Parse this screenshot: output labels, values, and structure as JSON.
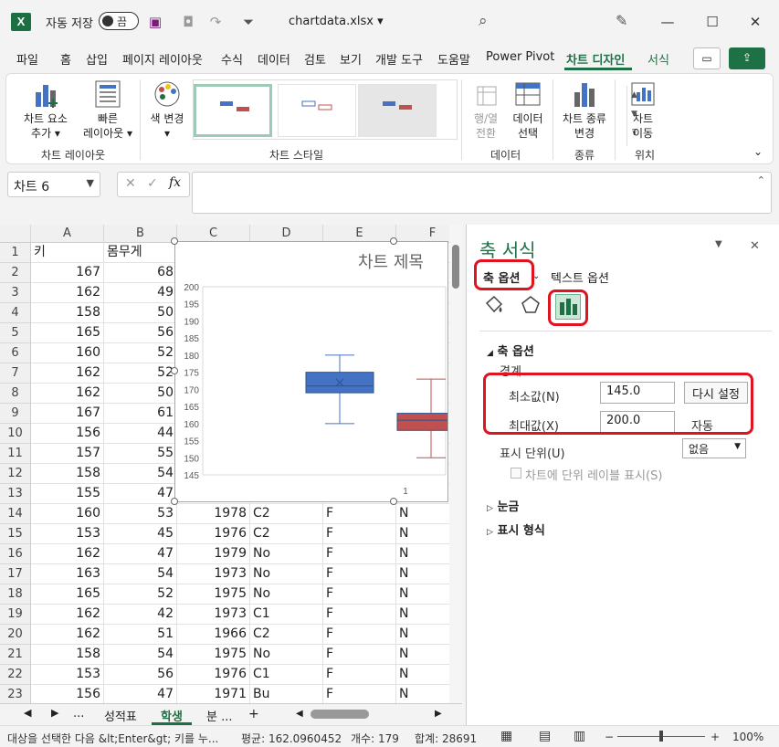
{
  "titlebar": {
    "autosave_label": "자동 저장",
    "autosave_state": "끔",
    "filename": "chartdata.xlsx ▾"
  },
  "tabs": [
    "파일",
    "홈",
    "삽입",
    "페이지 레이아웃",
    "수식",
    "데이터",
    "검토",
    "보기",
    "개발 도구",
    "도움말",
    "Power Pivot",
    "차트 디자인",
    "서식"
  ],
  "active_tab": "차트 디자인",
  "ribbon": {
    "add_element": [
      "차트 요소",
      "추가 ▾"
    ],
    "quick_layout": [
      "빠른",
      "레이아웃 ▾"
    ],
    "change_colors": [
      "색 변경",
      "▾"
    ],
    "switch_rowcol": [
      "행/열",
      "전환"
    ],
    "select_data": [
      "데이터",
      "선택"
    ],
    "change_type": [
      "차트 종류",
      "변경"
    ],
    "move_chart": [
      "차트",
      "이동"
    ],
    "groups": {
      "layouts": "차트 레이아웃",
      "styles": "차트 스타일",
      "data": "데이터",
      "type": "종류",
      "location": "위치"
    }
  },
  "namebox": "차트 6",
  "fx": "fx",
  "columns": [
    "A",
    "B",
    "C",
    "D",
    "E",
    "F"
  ],
  "row_numbers": [
    "1",
    "2",
    "3",
    "4",
    "5",
    "6",
    "7",
    "8",
    "9",
    "10",
    "11",
    "12",
    "13",
    "14",
    "15",
    "16",
    "17",
    "18",
    "19",
    "20",
    "21",
    "22",
    "23"
  ],
  "cells": [
    [
      "키",
      "몸무게",
      "",
      "",
      "",
      ""
    ],
    [
      "167",
      "68",
      "",
      "",
      "",
      ""
    ],
    [
      "162",
      "49",
      "",
      "",
      "",
      ""
    ],
    [
      "158",
      "50",
      "",
      "",
      "",
      ""
    ],
    [
      "165",
      "56",
      "",
      "",
      "",
      ""
    ],
    [
      "160",
      "52",
      "",
      "",
      "",
      ""
    ],
    [
      "162",
      "52",
      "",
      "",
      "",
      ""
    ],
    [
      "162",
      "50",
      "",
      "",
      "",
      ""
    ],
    [
      "167",
      "61",
      "",
      "",
      "",
      ""
    ],
    [
      "156",
      "44",
      "",
      "",
      "",
      ""
    ],
    [
      "157",
      "55",
      "",
      "",
      "",
      ""
    ],
    [
      "158",
      "54",
      "",
      "",
      "",
      ""
    ],
    [
      "155",
      "47",
      "",
      "",
      "",
      ""
    ],
    [
      "160",
      "53",
      "1978",
      "C2",
      "F",
      "N"
    ],
    [
      "153",
      "45",
      "1976",
      "C2",
      "F",
      "N"
    ],
    [
      "162",
      "47",
      "1979",
      "No",
      "F",
      "N"
    ],
    [
      "163",
      "54",
      "1973",
      "No",
      "F",
      "N"
    ],
    [
      "165",
      "52",
      "1975",
      "No",
      "F",
      "N"
    ],
    [
      "162",
      "42",
      "1973",
      "C1",
      "F",
      "N"
    ],
    [
      "162",
      "51",
      "1966",
      "C2",
      "F",
      "N"
    ],
    [
      "158",
      "54",
      "1975",
      "No",
      "F",
      "N"
    ],
    [
      "153",
      "56",
      "1976",
      "C1",
      "F",
      "N"
    ],
    [
      "156",
      "47",
      "1971",
      "Bu",
      "F",
      "N"
    ]
  ],
  "chart_data": {
    "type": "boxplot",
    "title": "차트 제목",
    "ylim": [
      145,
      200
    ],
    "yticks": [
      "200",
      "195",
      "190",
      "185",
      "180",
      "175",
      "170",
      "165",
      "160",
      "155",
      "150",
      "145"
    ],
    "xtick": "1",
    "series": [
      {
        "color": "#4472c4",
        "whisker_low": 160,
        "q1": 169,
        "median": 171,
        "mean": 172,
        "q3": 175,
        "whisker_high": 180
      },
      {
        "color": "#c0504d",
        "whisker_low": 150,
        "q1": 158,
        "median": 161,
        "q3": 163,
        "whisker_high": 173
      }
    ]
  },
  "sheets": {
    "nav_more": "...",
    "tab1": "성적표",
    "tab2": "학생",
    "tab3": "분 ...",
    "add": "+"
  },
  "statusbar": {
    "message": "대상을 선택한 다음 &lt;Enter&gt; 키를 누...",
    "average": "평균: 162.0960452",
    "count": "개수: 179",
    "sum": "합계: 28691",
    "zoom": "100%"
  },
  "pane": {
    "title": "축 서식",
    "axis_options_tab": "축 옵션",
    "text_options_tab": "텍스트 옵션",
    "section_axis": "축 옵션",
    "bounds_label": "경계",
    "min_label": "최소값(N)",
    "min_value": "145.0",
    "reset_button": "다시 설정",
    "max_label": "최대값(X)",
    "max_value": "200.0",
    "max_auto": "자동",
    "display_units_label": "표시 단위(U)",
    "display_units_value": "없음",
    "show_units_label": "차트에 단위 레이블 표시(S)",
    "ticks_section": "눈금",
    "number_section": "표시 형식"
  }
}
